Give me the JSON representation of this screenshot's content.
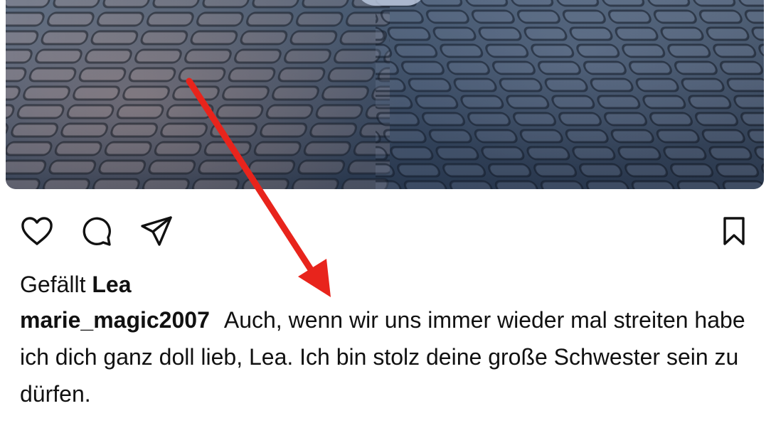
{
  "post": {
    "image_icon": "post-photo",
    "actions": {
      "like_icon": "heart-icon",
      "comment_icon": "comment-icon",
      "share_icon": "send-icon",
      "save_icon": "bookmark-icon"
    },
    "likes": {
      "prefix": "Gefällt",
      "liked_by": "Lea"
    },
    "caption": {
      "username": "marie_magic2007",
      "text": "Auch, wenn wir uns immer wieder mal streiten habe ich dich ganz doll lieb, Lea. Ich bin stolz deine große Schwester sein zu dürfen."
    }
  },
  "annotation": {
    "color": "#e8241c",
    "icon": "arrow-annotation"
  }
}
